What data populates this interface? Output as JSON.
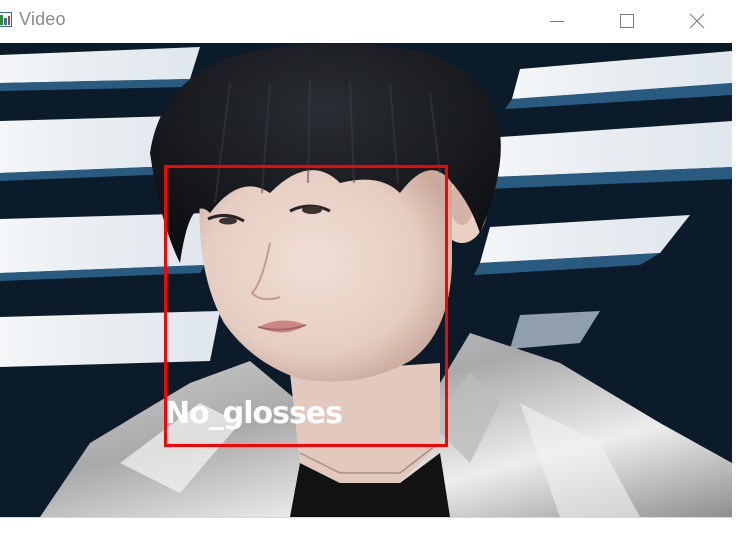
{
  "window": {
    "title": "Video",
    "controls": {
      "minimize": "minimize-icon",
      "maximize": "maximize-icon",
      "close": "close-icon"
    }
  },
  "detection": {
    "label": "No_glosses",
    "box_color": "#ff0000",
    "label_color": "#ffffff"
  }
}
